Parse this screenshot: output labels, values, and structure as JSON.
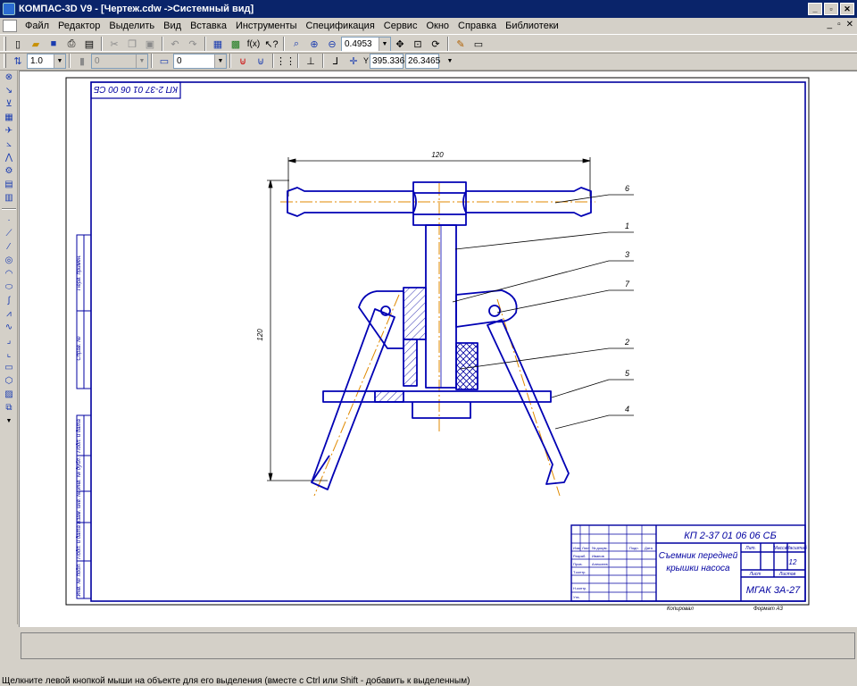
{
  "window": {
    "title": "КОМПАС-3D V9 - [Чертеж.cdw ->Системный вид]",
    "minimize": "_",
    "maximize": "▫",
    "close": "✕"
  },
  "menu": {
    "items": [
      "Файл",
      "Редактор",
      "Выделить",
      "Вид",
      "Вставка",
      "Инструменты",
      "Спецификация",
      "Сервис",
      "Окно",
      "Справка",
      "Библиотеки"
    ],
    "mdi_min": "_",
    "mdi_restore": "▫",
    "mdi_close": "✕"
  },
  "toolbar": {
    "zoom_value": "0.4953",
    "step_value": "1.0",
    "layer_value": "0",
    "style_value": "0",
    "coord_x": "395.336",
    "coord_y": "26.3465",
    "coord_label": "Y"
  },
  "drawing": {
    "stamp_code_rotated": "КП 2-37 01 06 00 СБ",
    "dim_width": "120",
    "dim_height": "120",
    "leaders": [
      "6",
      "1",
      "3",
      "7",
      "2",
      "5",
      "4"
    ],
    "title_block": {
      "designation": "КП 2-37 01 06 06 СБ",
      "name_line1": "Съемник передней",
      "name_line2": "крышки насоса",
      "sheets": "12",
      "org": "МГАК 3А-27",
      "copied": "Копировал",
      "format": "Формат  А3",
      "hdr_lit": "Лит.",
      "hdr_mass": "Масса",
      "hdr_scale": "Масштаб",
      "hdr_sheet": "Лист",
      "hdr_sheets": "Листов",
      "row_dev": "Разраб.",
      "row_check": "Пров.",
      "row_tcontr": "Т.контр.",
      "row_ncontr": "Н.контр.",
      "row_appr": "Утв.",
      "dev_name": "Иванов",
      "check_name": "Алексеев",
      "hdr_izm": "Изм.",
      "hdr_list": "Лист",
      "hdr_doc": "№ докум.",
      "hdr_sign": "Подп.",
      "hdr_date": "Дата"
    },
    "side_labels": [
      "Подп. и дата",
      "Инв. № дубл.",
      "Взам. инв. №",
      "Подп. и дата",
      "Инв. № подл.",
      "Справ. №",
      "Перв. примен."
    ]
  },
  "status": {
    "text": "Щелкните левой кнопкой мыши на объекте для его выделения (вместе с Ctrl или Shift - добавить к выделенным)"
  }
}
